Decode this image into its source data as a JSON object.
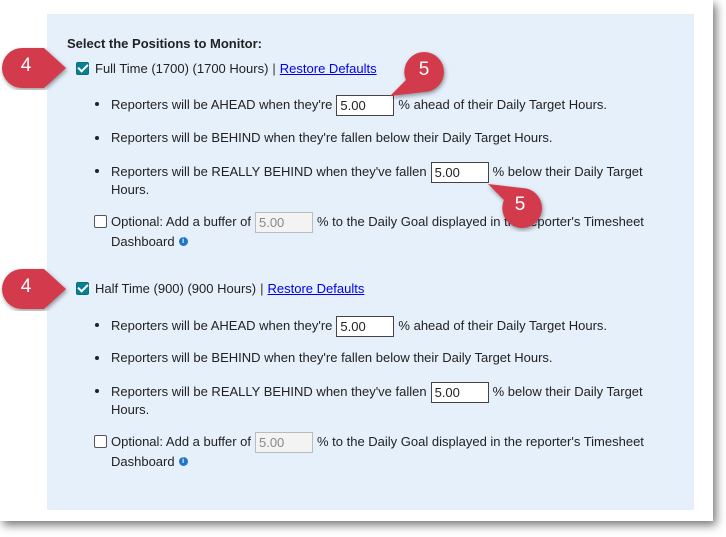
{
  "heading": "Select the Positions to Monitor:",
  "callouts": {
    "left_label": "4",
    "right_label": "5"
  },
  "positions": [
    {
      "checked": true,
      "label": "Full Time (1700) (1700 Hours)",
      "separator": "|",
      "restore_label": "Restore Defaults",
      "ahead_pre": "Reporters will be AHEAD when they're",
      "ahead_value": "5.00",
      "ahead_post": "% ahead of their Daily Target Hours.",
      "behind": "Reporters will be BEHIND when they're fallen below their Daily Target Hours.",
      "really_pre": "Reporters will be REALLY BEHIND when they've fallen",
      "really_value": "5.00",
      "really_post": "% below their Daily Target",
      "really_post2": "Hours.",
      "optional_checked": false,
      "optional_pre": "Optional: Add a buffer of",
      "optional_value": "5.00",
      "optional_post": "% to the Daily Goal displayed in the reporter's Timesheet",
      "optional_post2": "Dashboard"
    },
    {
      "checked": true,
      "label": "Half Time (900) (900 Hours)",
      "separator": "|",
      "restore_label": "Restore Defaults",
      "ahead_pre": "Reporters will be AHEAD when they're",
      "ahead_value": "5.00",
      "ahead_post": "% ahead of their Daily Target Hours.",
      "behind": "Reporters will be BEHIND when they're fallen below their Daily Target Hours.",
      "really_pre": "Reporters will be REALLY BEHIND when they've fallen",
      "really_value": "5.00",
      "really_post": "% below their Daily Target",
      "really_post2": "Hours.",
      "optional_checked": false,
      "optional_pre": "Optional: Add a buffer of",
      "optional_value": "5.00",
      "optional_post": "% to the Daily Goal displayed in the reporter's Timesheet",
      "optional_post2": "Dashboard"
    }
  ],
  "colors": {
    "panel_bg": "#e6f0fb",
    "callout": "#d33a4c",
    "checkbox": "#0a7f8f",
    "link": "#0000ee"
  },
  "icons": {
    "info": "info-icon",
    "check": "checkmark-icon"
  }
}
